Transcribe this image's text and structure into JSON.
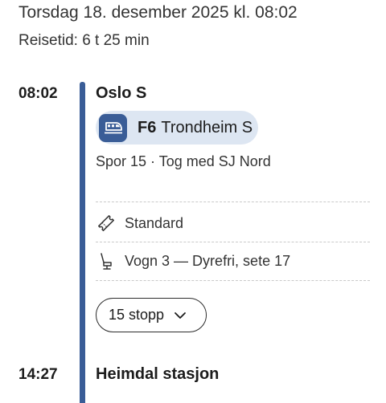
{
  "header": {
    "date_time": "Torsdag 18. desember 2025 kl. 08:02",
    "travel_time": "Reisetid: 6 t 25 min"
  },
  "departure": {
    "time": "08:02",
    "station": "Oslo S",
    "line": {
      "code": "F6",
      "destination": "Trondheim S",
      "icon": "train-icon"
    },
    "platform_info": "Spor 15 · Tog med SJ Nord",
    "ticket_class": {
      "label": "Standard",
      "icon": "ticket-icon"
    },
    "seat": {
      "label": "Vogn 3 — Dyrefri, sete 17",
      "icon": "seat-icon"
    },
    "stops_button": {
      "label": "15 stopp",
      "icon": "chevron-down-icon"
    }
  },
  "arrival": {
    "time": "14:27",
    "station": "Heimdal stasjon"
  },
  "colors": {
    "accent": "#3a5d97",
    "badge_background": "#dde6f2",
    "text": "#1c1c1c"
  }
}
